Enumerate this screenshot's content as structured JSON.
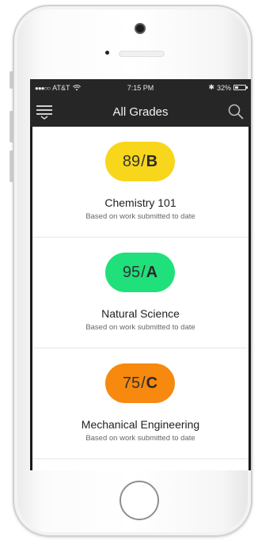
{
  "status_bar": {
    "signal_dots": "●●●○○",
    "carrier": "AT&T",
    "time": "7:15 PM",
    "bluetooth": "✱",
    "battery_percent": "32%",
    "battery_level": 0.32
  },
  "nav": {
    "title": "All Grades",
    "menu_icon": "menu-icon",
    "search_icon": "search-icon"
  },
  "grades": [
    {
      "score": "89",
      "separator": "/",
      "letter": "B",
      "course": "Chemistry 101",
      "subtitle": "Based on work submitted to date",
      "color": "#f7d61c"
    },
    {
      "score": "95",
      "separator": "/",
      "letter": "A",
      "course": "Natural Science",
      "subtitle": "Based on work submitted to date",
      "color": "#1fe07a"
    },
    {
      "score": "75",
      "separator": "/",
      "letter": "C",
      "course": "Mechanical Engineering",
      "subtitle": "Based on work submitted to date",
      "color": "#f7890f"
    }
  ]
}
